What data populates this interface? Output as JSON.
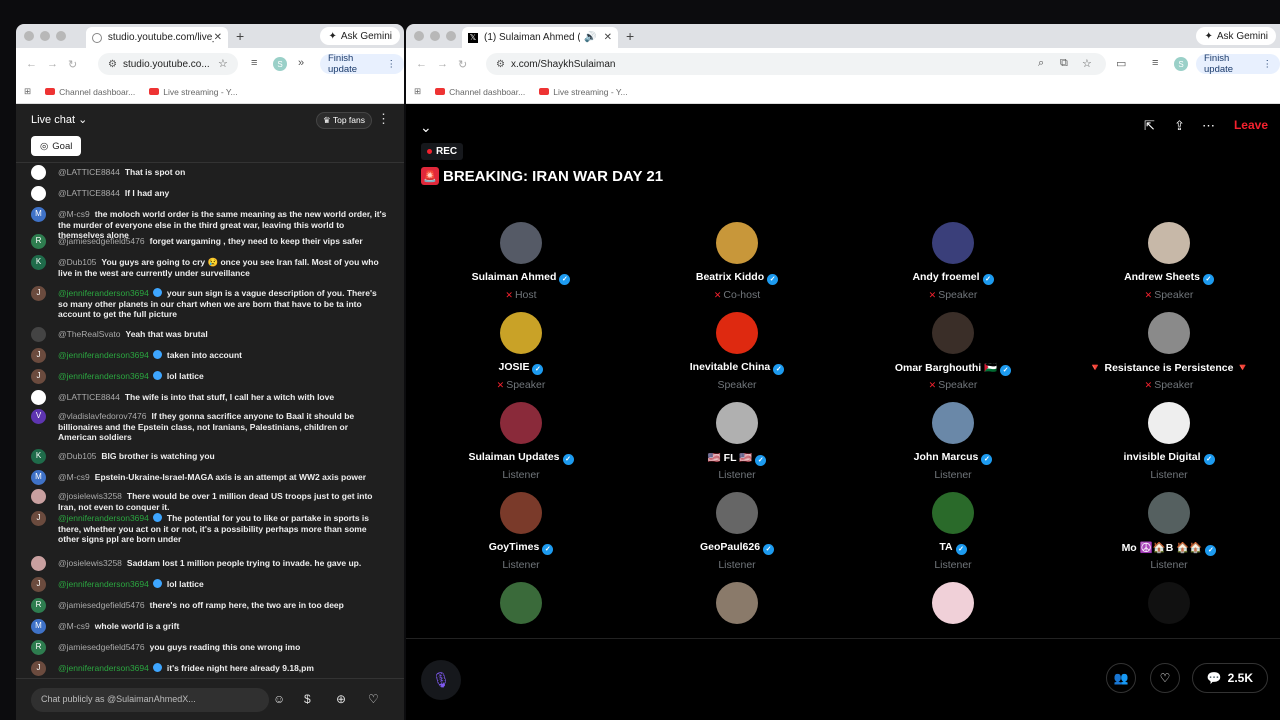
{
  "left_window": {
    "tab_title": "studio.youtube.com/live_chat",
    "url": "studio.youtube.co...",
    "gemini": "Ask Gemini",
    "finish_update": "Finish update",
    "bookmarks": [
      "Channel dashboar...",
      "Live streaming - Y..."
    ],
    "chat": {
      "title": "Live chat",
      "top_fans": "Top fans",
      "goal": "Goal",
      "messages": [
        {
          "author": "@LATTICE8844",
          "text": "That is spot on",
          "member": false,
          "avatar_color": "#ffffff",
          "initial": ""
        },
        {
          "author": "@LATTICE8844",
          "text": "If I had any",
          "member": false,
          "avatar_color": "#ffffff",
          "initial": ""
        },
        {
          "author": "@M-cs9",
          "text": "the moloch world order is the same meaning as the new world order, it's the murder of everyone else in the third great war, leaving this world to themselves alone",
          "member": false,
          "avatar_color": "#3f72c7",
          "initial": "M"
        },
        {
          "author": "@jamiesedgefield5476",
          "text": "forget wargaming , they need to keep their vips safer",
          "member": false,
          "avatar_color": "#2e7d4f",
          "initial": "R"
        },
        {
          "author": "@Dub105",
          "text": "You guys are going to cry 😢 once you see Iran fall. Most of you who live in the west are currently under surveillance",
          "member": false,
          "avatar_color": "#1f6b4a",
          "initial": "K"
        },
        {
          "author": "@jenniferanderson3694",
          "text": "your sun sign is a vague description of you. There's so many other planets in our chart when we are born that have to be ta into account to get the full picture",
          "member": true,
          "avatar_color": "#6b4b3e",
          "initial": "J"
        },
        {
          "author": "@TheRealSvato",
          "text": "Yeah that was brutal",
          "member": false,
          "avatar_color": "#444444",
          "initial": ""
        },
        {
          "author": "@jenniferanderson3694",
          "text": "taken into account",
          "member": true,
          "avatar_color": "#6b4b3e",
          "initial": "J"
        },
        {
          "author": "@jenniferanderson3694",
          "text": "lol lattice",
          "member": true,
          "avatar_color": "#6b4b3e",
          "initial": "J"
        },
        {
          "author": "@LATTICE8844",
          "text": "The wife is into that stuff, I call her a witch with love",
          "member": false,
          "avatar_color": "#ffffff",
          "initial": ""
        },
        {
          "author": "@vladislavfedorov7476",
          "text": "If they gonna sacrifice anyone to Baal it should be billionaires and the Epstein class, not Iranians, Palestinians, children or American soldiers",
          "member": false,
          "avatar_color": "#5e35b1",
          "initial": "V"
        },
        {
          "author": "@Dub105",
          "text": "BIG brother is watching you",
          "member": false,
          "avatar_color": "#1f6b4a",
          "initial": "K"
        },
        {
          "author": "@M-cs9",
          "text": "Epstein-Ukraine-Israel-MAGA axis is an attempt at WW2 axis power",
          "member": false,
          "avatar_color": "#3f72c7",
          "initial": "M"
        },
        {
          "author": "@josielewis3258",
          "text": "There would be over 1 million dead US troops just to get into Iran, not even to conquer it.",
          "member": false,
          "avatar_color": "#c9a0a0",
          "initial": ""
        },
        {
          "author": "@jenniferanderson3694",
          "text": "The potential for you to like or partake in sports is there, whether you act on it or not, it's a possibility perhaps more than some other signs ppl are born under",
          "member": true,
          "avatar_color": "#6b4b3e",
          "initial": "J"
        },
        {
          "author": "@josielewis3258",
          "text": "Saddam lost 1 million people trying to invade. he gave up.",
          "member": false,
          "avatar_color": "#c9a0a0",
          "initial": ""
        },
        {
          "author": "@jenniferanderson3694",
          "text": "lol lattice",
          "member": true,
          "avatar_color": "#6b4b3e",
          "initial": "J"
        },
        {
          "author": "@jamiesedgefield5476",
          "text": "there's no off ramp here, the two are in too deep",
          "member": false,
          "avatar_color": "#2e7d4f",
          "initial": "R"
        },
        {
          "author": "@M-cs9",
          "text": "whole world is a grift",
          "member": false,
          "avatar_color": "#3f72c7",
          "initial": "M"
        },
        {
          "author": "@jamiesedgefield5476",
          "text": "you guys reading this one wrong imo",
          "member": false,
          "avatar_color": "#2e7d4f",
          "initial": "R"
        },
        {
          "author": "@jenniferanderson3694",
          "text": "it's fridee night here already 9.18,pm",
          "member": true,
          "avatar_color": "#6b4b3e",
          "initial": "J"
        }
      ],
      "input_placeholder": "Chat publicly as @SulaimanAhmedX..."
    }
  },
  "right_window": {
    "tab_title": "(1) Sulaiman Ahmed (@Sh",
    "url": "x.com/ShaykhSulaiman",
    "gemini": "Ask Gemini",
    "finish_update": "Finish update",
    "bookmarks": [
      "Channel dashboar...",
      "Live streaming - Y..."
    ],
    "space": {
      "leave": "Leave",
      "rec": "REC",
      "title": "BREAKING: IRAN WAR DAY 21",
      "count": "2.5K",
      "participants": [
        {
          "name": "Sulaiman Ahmed",
          "role": "Host",
          "verified": true,
          "muted": true,
          "color": "#555a66"
        },
        {
          "name": "Beatrix Kiddo",
          "role": "Co-host",
          "verified": true,
          "muted": true,
          "color": "#c8973a"
        },
        {
          "name": "Andy froemel",
          "role": "Speaker",
          "verified": true,
          "muted": true,
          "color": "#3a3f7a"
        },
        {
          "name": "Andrew Sheets",
          "role": "Speaker",
          "verified": true,
          "muted": true,
          "color": "#c7b8a8"
        },
        {
          "name": "JOSIE",
          "role": "Speaker",
          "verified": true,
          "muted": true,
          "color": "#c9a227"
        },
        {
          "name": "Inevitable China",
          "role": "Speaker",
          "verified": true,
          "muted": false,
          "color": "#de2910"
        },
        {
          "name": "Omar Barghouthi 🇵🇸",
          "role": "Speaker",
          "verified": true,
          "muted": true,
          "color": "#3a2e28"
        },
        {
          "name": "🔻 Resistance is Persistence 🔻",
          "role": "Speaker",
          "verified": false,
          "muted": true,
          "color": "#8a8a8a"
        },
        {
          "name": "Sulaiman Updates",
          "role": "Listener",
          "verified": true,
          "muted": false,
          "color": "#8a2a3a"
        },
        {
          "name": "🇺🇸 FL 🇺🇸",
          "role": "Listener",
          "verified": true,
          "muted": false,
          "color": "#b0b0b0"
        },
        {
          "name": "John Marcus",
          "role": "Listener",
          "verified": true,
          "muted": false,
          "color": "#6a88a8"
        },
        {
          "name": "invisible Digital",
          "role": "Listener",
          "verified": true,
          "muted": false,
          "color": "#eeeeee"
        },
        {
          "name": "GoyTimes",
          "role": "Listener",
          "verified": true,
          "muted": false,
          "color": "#7a3a2a"
        },
        {
          "name": "GeoPaul626",
          "role": "Listener",
          "verified": true,
          "muted": false,
          "color": "#666666"
        },
        {
          "name": "TA",
          "role": "Listener",
          "verified": true,
          "muted": false,
          "color": "#2a6a2a"
        },
        {
          "name": "Mo ☮️🏠B 🏠🏠",
          "role": "Listener",
          "verified": true,
          "muted": false,
          "color": "#556060"
        },
        {
          "name": "",
          "role": "",
          "verified": false,
          "muted": false,
          "color": "#3a6a3a"
        },
        {
          "name": "",
          "role": "",
          "verified": false,
          "muted": false,
          "color": "#8a7a6a"
        },
        {
          "name": "",
          "role": "",
          "verified": false,
          "muted": false,
          "color": "#f0d0d8"
        },
        {
          "name": "",
          "role": "",
          "verified": false,
          "muted": false,
          "color": "#111111"
        }
      ]
    }
  }
}
